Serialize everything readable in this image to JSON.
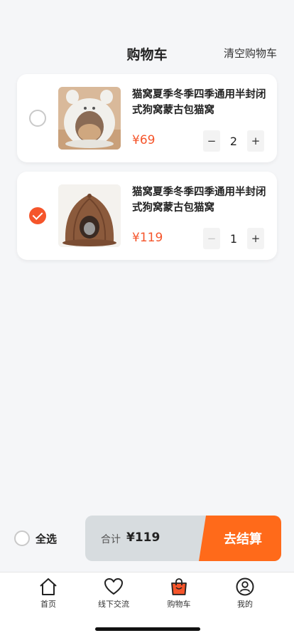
{
  "header": {
    "title": "购物车",
    "clear_label": "清空购物车"
  },
  "cart": {
    "items": [
      {
        "name": "猫窝夏季冬季四季通用半封闭式狗窝蒙古包猫窝",
        "price": "¥69",
        "quantity": "2",
        "selected": false,
        "minus_enabled": true
      },
      {
        "name": "猫窝夏季冬季四季通用半封闭式狗窝蒙古包猫窝",
        "price": "¥119",
        "quantity": "1",
        "selected": true,
        "minus_enabled": false
      }
    ],
    "stepper": {
      "minus": "−",
      "plus": "+"
    }
  },
  "footer": {
    "select_all_label": "全选",
    "total_label": "合计",
    "total_value": "¥119",
    "checkout_label": "去结算"
  },
  "tabbar": {
    "tabs": [
      {
        "label": "首页",
        "icon": "home-icon"
      },
      {
        "label": "线下交流",
        "icon": "heart-icon"
      },
      {
        "label": "购物车",
        "icon": "shopping-bag-icon"
      },
      {
        "label": "我的",
        "icon": "user-icon"
      }
    ],
    "active_index": 2
  },
  "colors": {
    "accent": "#f5552b",
    "checkout": "#ff6a1a",
    "active_tab_icon": "#f5552b"
  }
}
